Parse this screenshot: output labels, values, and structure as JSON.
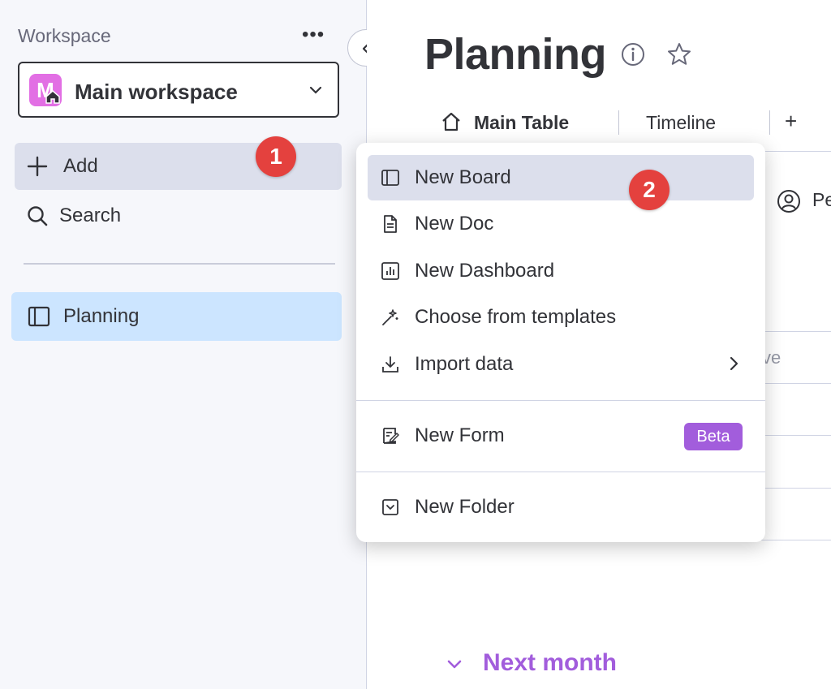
{
  "sidebar": {
    "workspace_label": "Workspace",
    "more_label": "•••",
    "workspace": {
      "avatar_letter": "M",
      "name": "Main workspace",
      "avatar_color": "#e26fe4"
    },
    "add_label": "Add",
    "search_label": "Search",
    "boards": [
      {
        "label": "Planning"
      }
    ]
  },
  "annotations": {
    "step1": "1",
    "step2": "2",
    "color": "#e4413e"
  },
  "board": {
    "title": "Planning",
    "tabs": [
      {
        "label": "Main Table"
      },
      {
        "label": "Timeline"
      }
    ],
    "add_view_label": "+",
    "column_person_label": "Pe",
    "partial_text": "ve",
    "group_title": "Next month",
    "group_color": "#a25ddc"
  },
  "add_menu": {
    "items": [
      {
        "label": "New Board",
        "icon": "board-icon"
      },
      {
        "label": "New Doc",
        "icon": "doc-icon"
      },
      {
        "label": "New Dashboard",
        "icon": "dashboard-icon"
      },
      {
        "label": "Choose from templates",
        "icon": "magic-wand-icon"
      },
      {
        "label": "Import data",
        "icon": "download-icon"
      },
      {
        "label": "New Form",
        "icon": "form-icon",
        "badge": "Beta"
      },
      {
        "label": "New Folder",
        "icon": "folder-icon"
      }
    ],
    "highlight_color": "#dcdfec"
  }
}
